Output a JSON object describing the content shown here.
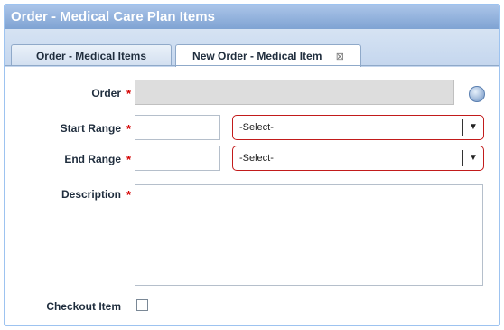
{
  "window": {
    "title": "Order - Medical Care Plan Items"
  },
  "tabs": [
    {
      "label": "Order - Medical Items"
    },
    {
      "label": "New Order - Medical Item",
      "close_symbol": "⊠"
    }
  ],
  "form": {
    "order_label": "Order",
    "start_range_label": "Start Range",
    "start_range_value": "",
    "start_range_select": "-Select-",
    "end_range_label": "End Range",
    "end_range_value": "",
    "end_range_select": "-Select-",
    "description_label": "Description",
    "description_value": "",
    "checkout_label": "Checkout Item",
    "checkout_checked": false,
    "required_marker": "*"
  },
  "icons": {
    "order_lookup": "refresh-icon",
    "dropdown": "chevron-down-icon"
  },
  "colors": {
    "titlebar": "#7fa3d3",
    "required": "#d40000",
    "select_border": "#c21b1b"
  }
}
